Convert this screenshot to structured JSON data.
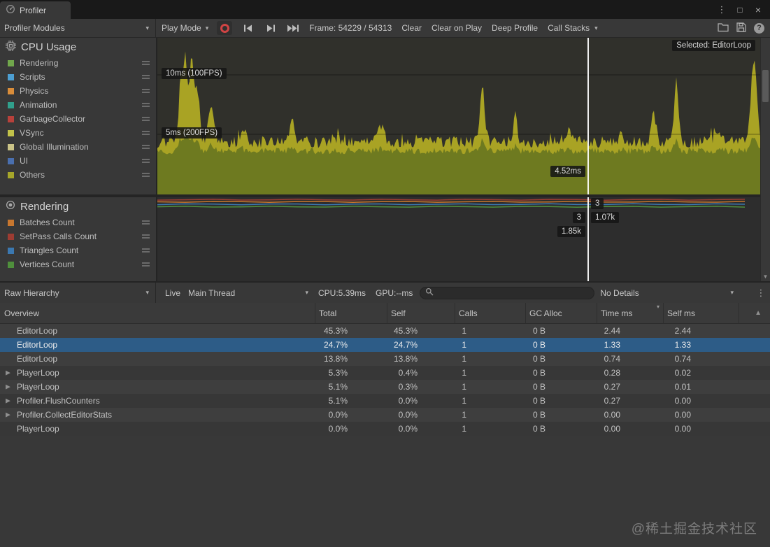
{
  "window": {
    "tab": "Profiler"
  },
  "icons": {
    "menu": "⋮",
    "maximize": "□",
    "close": "×",
    "dropdown": "▾",
    "kebab": "⋮",
    "row_arrow": "▶",
    "sort_desc": "▾",
    "scroll_up": "▲",
    "scroll_down": "▼",
    "help": "?"
  },
  "toolbar": {
    "modules": "Profiler Modules",
    "play_mode": "Play Mode",
    "frame": "Frame: 54229 / 54313",
    "clear": "Clear",
    "clear_on_play": "Clear on Play",
    "deep_profile": "Deep Profile",
    "call_stacks": "Call Stacks"
  },
  "cpu_module": {
    "title": "CPU Usage",
    "legend": [
      {
        "label": "Rendering",
        "color": "#71a74c"
      },
      {
        "label": "Scripts",
        "color": "#4d9fd2"
      },
      {
        "label": "Physics",
        "color": "#d98d3a"
      },
      {
        "label": "Animation",
        "color": "#31a08c"
      },
      {
        "label": "GarbageCollector",
        "color": "#b8413b"
      },
      {
        "label": "VSync",
        "color": "#c3c34a"
      },
      {
        "label": "Global Illumination",
        "color": "#cbc487"
      },
      {
        "label": "UI",
        "color": "#4a6fae"
      },
      {
        "label": "Others",
        "color": "#a6a62a"
      }
    ],
    "grid_label_10ms": "10ms (100FPS)",
    "grid_label_5ms": "5ms (200FPS)",
    "selected_badge": "Selected: EditorLoop",
    "frame_time_badge": "4.52ms",
    "chart_colors": {
      "area_top": "#a9a324",
      "area_bottom": "#6e7a20"
    }
  },
  "render_module": {
    "title": "Rendering",
    "legend": [
      {
        "label": "Batches Count",
        "color": "#c8772f"
      },
      {
        "label": "SetPass Calls Count",
        "color": "#9e3c32"
      },
      {
        "label": "Triangles Count",
        "color": "#3b78b0"
      },
      {
        "label": "Vertices Count",
        "color": "#4f8f3c"
      }
    ],
    "badge_top": "3",
    "badge_mid_left": "3",
    "badge_mid_right": "1.07k",
    "badge_bottom": "1.85k"
  },
  "hierarchy": {
    "mode": "Raw Hierarchy",
    "live": "Live",
    "thread": "Main Thread",
    "cpu_time": "CPU:5.39ms",
    "gpu_time": "GPU:--ms",
    "details": "No Details",
    "columns": [
      "Overview",
      "Total",
      "Self",
      "Calls",
      "GC Alloc",
      "Time ms",
      "Self ms"
    ],
    "rows": [
      {
        "name": "EditorLoop",
        "total": "45.3%",
        "self": "45.3%",
        "calls": "1",
        "gc": "0 B",
        "time": "2.44",
        "self_ms": "2.44",
        "expandable": false,
        "selected": false
      },
      {
        "name": "EditorLoop",
        "total": "24.7%",
        "self": "24.7%",
        "calls": "1",
        "gc": "0 B",
        "time": "1.33",
        "self_ms": "1.33",
        "expandable": false,
        "selected": true
      },
      {
        "name": "EditorLoop",
        "total": "13.8%",
        "self": "13.8%",
        "calls": "1",
        "gc": "0 B",
        "time": "0.74",
        "self_ms": "0.74",
        "expandable": false,
        "selected": false
      },
      {
        "name": "PlayerLoop",
        "total": "5.3%",
        "self": "0.4%",
        "calls": "1",
        "gc": "0 B",
        "time": "0.28",
        "self_ms": "0.02",
        "expandable": true,
        "selected": false
      },
      {
        "name": "PlayerLoop",
        "total": "5.1%",
        "self": "0.3%",
        "calls": "1",
        "gc": "0 B",
        "time": "0.27",
        "self_ms": "0.01",
        "expandable": true,
        "selected": false
      },
      {
        "name": "Profiler.FlushCounters",
        "total": "5.1%",
        "self": "0.0%",
        "calls": "1",
        "gc": "0 B",
        "time": "0.27",
        "self_ms": "0.00",
        "expandable": true,
        "selected": false
      },
      {
        "name": "Profiler.CollectEditorStats",
        "total": "0.0%",
        "self": "0.0%",
        "calls": "1",
        "gc": "0 B",
        "time": "0.00",
        "self_ms": "0.00",
        "expandable": true,
        "selected": false
      },
      {
        "name": "PlayerLoop",
        "total": "0.0%",
        "self": "0.0%",
        "calls": "1",
        "gc": "0 B",
        "time": "0.00",
        "self_ms": "0.00",
        "expandable": false,
        "selected": false
      }
    ]
  },
  "watermark": "@稀土掘金技术社区"
}
